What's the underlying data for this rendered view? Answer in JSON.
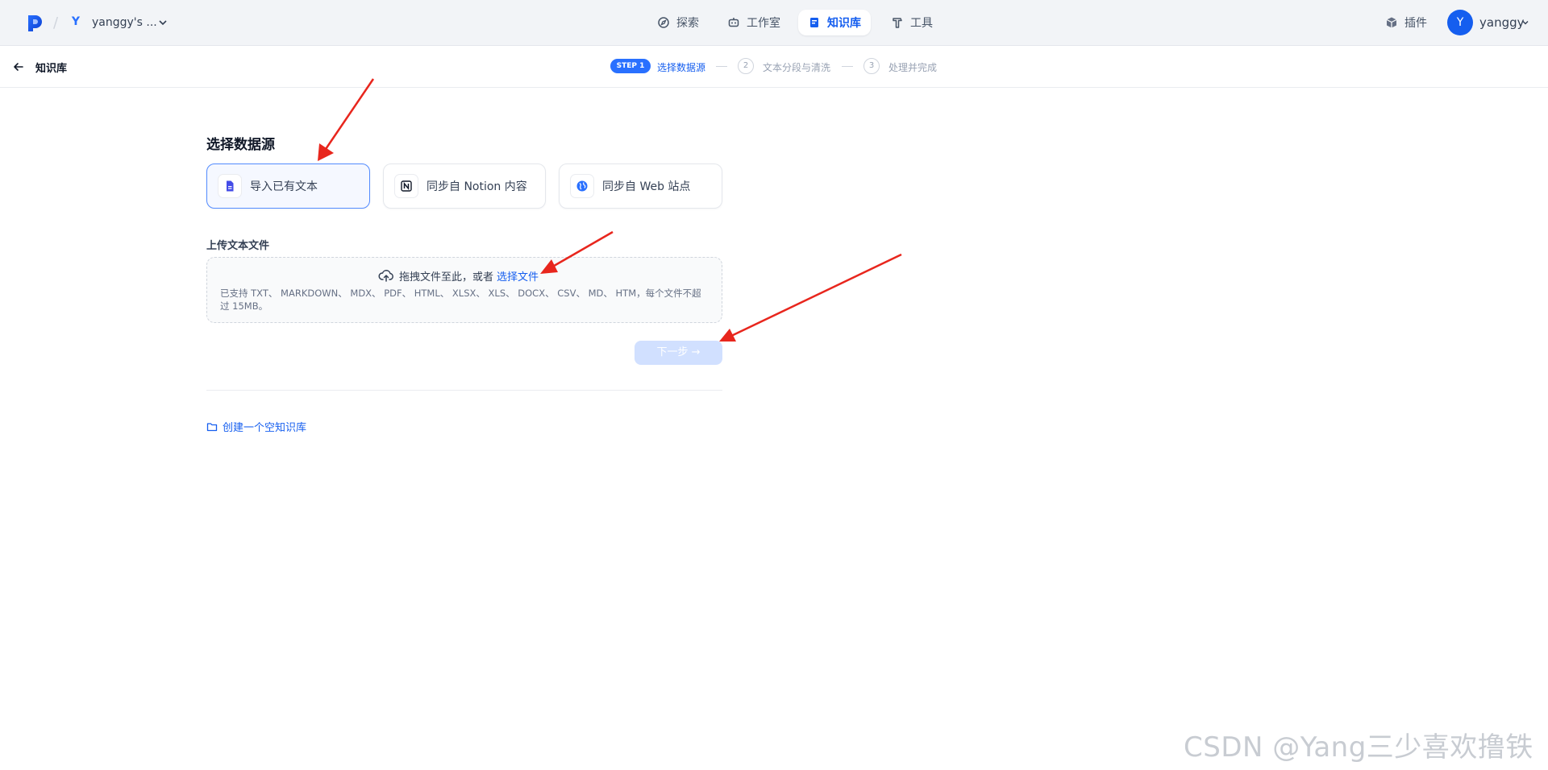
{
  "header": {
    "workspace_initial": "Y",
    "workspace_name": "yanggy's ...",
    "nav": {
      "explore": "探索",
      "studio": "工作室",
      "knowledge": "知识库",
      "tools": "工具"
    },
    "plugins_label": "插件",
    "user_initial": "Y",
    "user_name": "yanggy"
  },
  "subheader": {
    "back_label": "知识库",
    "steps": {
      "step1_badge": "STEP 1",
      "step1_label": "选择数据源",
      "step2_number": "2",
      "step2_label": "文本分段与清洗",
      "step3_number": "3",
      "step3_label": "处理并完成"
    }
  },
  "main": {
    "section_title": "选择数据源",
    "sources": {
      "file": "导入已有文本",
      "notion": "同步自 Notion 内容",
      "web": "同步自 Web 站点"
    },
    "upload": {
      "title": "上传文本文件",
      "drop_text": "拖拽文件至此，或者",
      "select_link": "选择文件",
      "help": "已支持 TXT、 MARKDOWN、 MDX、 PDF、 HTML、 XLSX、 XLS、 DOCX、 CSV、 MD、 HTM，每个文件不超过 15MB。"
    },
    "next_button": "下一步 →",
    "create_empty": "创建一个空知识库"
  },
  "watermark": "CSDN @Yang三少喜欢撸铁",
  "colors": {
    "accent": "#155eef",
    "annotation_arrow": "#e8261d"
  }
}
